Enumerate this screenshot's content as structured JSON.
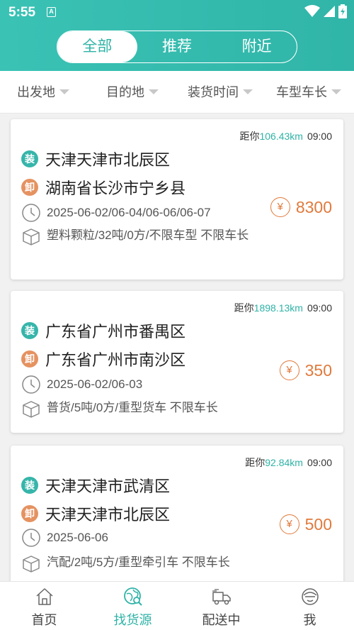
{
  "status": {
    "time": "5:55",
    "a_badge": "A"
  },
  "segments": [
    {
      "label": "全部",
      "active": true
    },
    {
      "label": "推荐",
      "active": false
    },
    {
      "label": "附近",
      "active": false
    }
  ],
  "filters": [
    "出发地",
    "目的地",
    "装货时间",
    "车型车长"
  ],
  "load_badge": "装",
  "unload_badge": "卸",
  "distance_prefix": "距你",
  "yen_symbol": "¥",
  "cards": [
    {
      "distance": "106.43km",
      "time": "09:00",
      "from": "天津天津市北辰区",
      "to": "湖南省长沙市宁乡县",
      "dates": "2025-06-02/06-04/06-06/06-07",
      "goods": "塑料颗粒/32吨/0方/不限车型 不限车长",
      "price": "8300"
    },
    {
      "distance": "1898.13km",
      "time": "09:00",
      "from": "广东省广州市番禺区",
      "to": "广东省广州市南沙区",
      "dates": "2025-06-02/06-03",
      "goods": "普货/5吨/0方/重型货车 不限车长",
      "price": "350"
    },
    {
      "distance": "92.84km",
      "time": "09:00",
      "from": "天津天津市武清区",
      "to": "天津天津市北辰区",
      "dates": "2025-06-06",
      "goods": "汽配/2吨/5方/重型牵引车 不限车长",
      "price": "500"
    }
  ],
  "tabs": [
    {
      "label": "首页",
      "icon": "home-icon",
      "active": false
    },
    {
      "label": "找货源",
      "icon": "find-goods-icon",
      "active": true
    },
    {
      "label": "配送中",
      "icon": "truck-icon",
      "active": false
    },
    {
      "label": "我",
      "icon": "profile-icon",
      "active": false
    }
  ],
  "colors": {
    "primary": "#2fb3a6",
    "unload": "#e59261",
    "price": "#e07a3c"
  }
}
